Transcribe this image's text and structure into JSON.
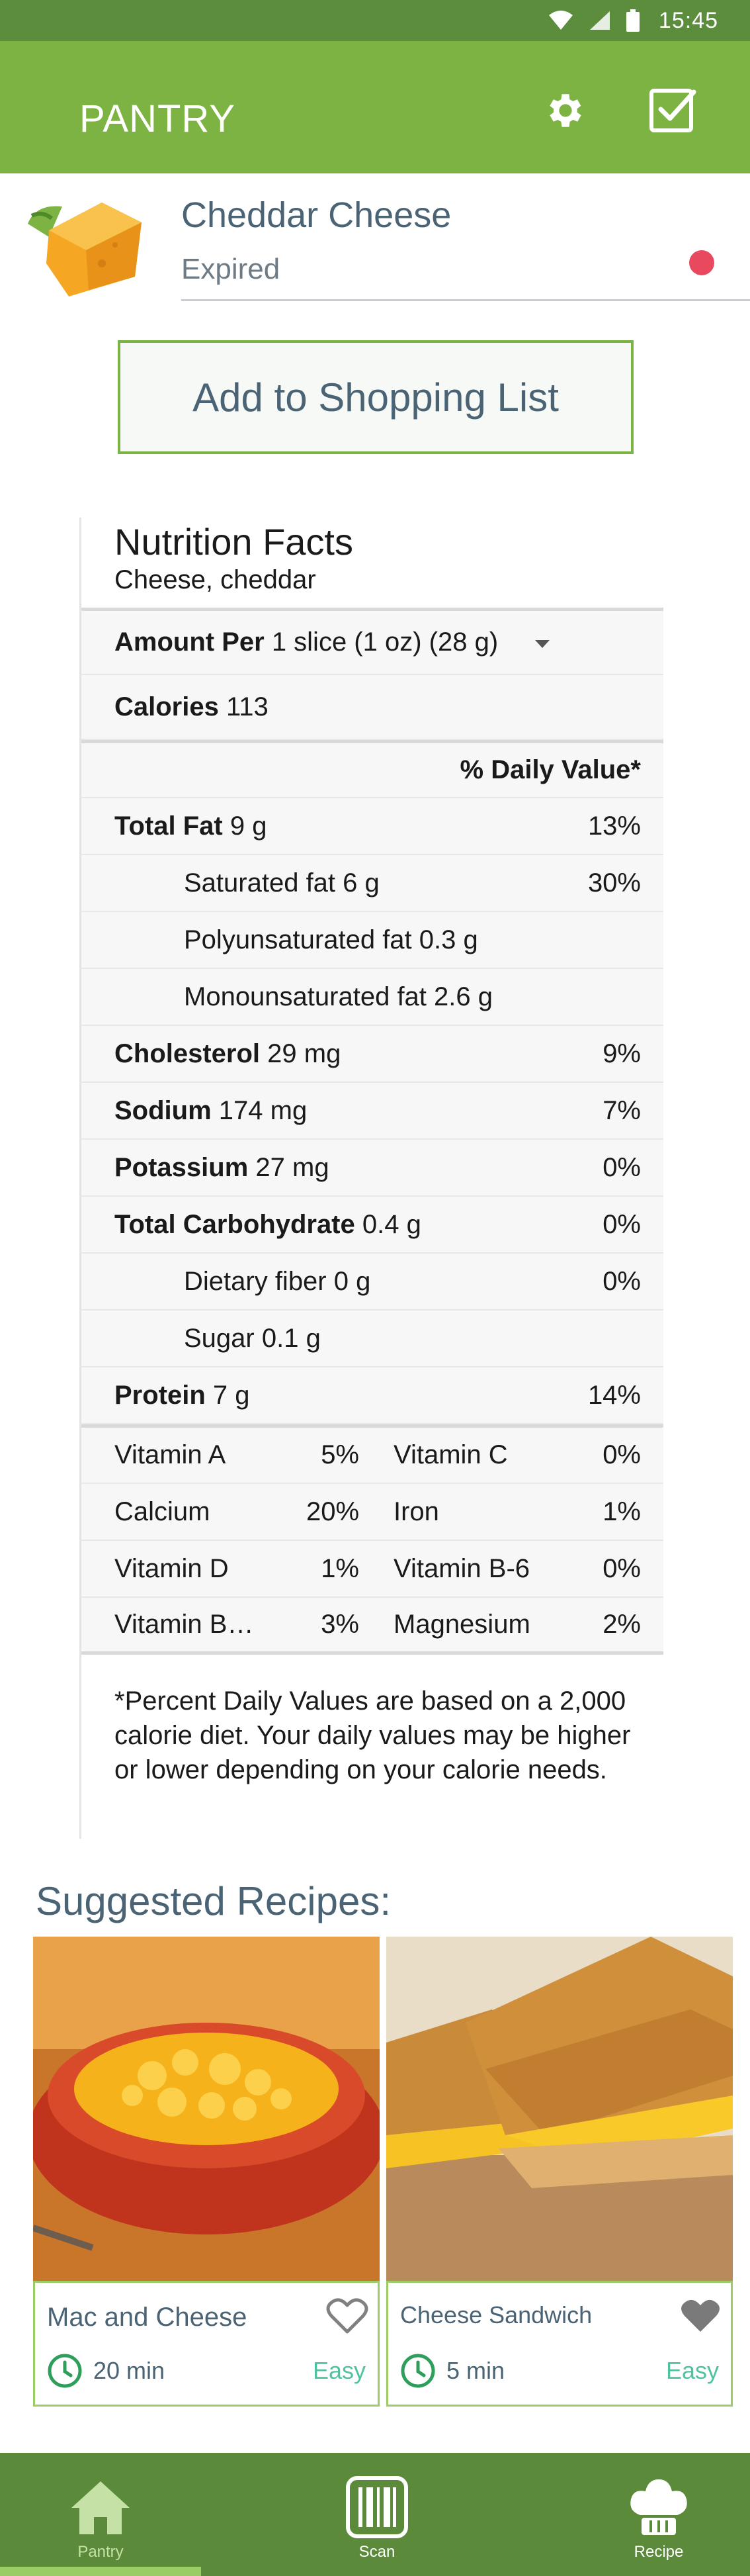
{
  "status_bar": {
    "time": "15:45"
  },
  "app_bar": {
    "title": "PANTRY"
  },
  "item": {
    "name": "Cheddar Cheese",
    "status": "Expired"
  },
  "actions": {
    "add_to_list": "Add to Shopping List"
  },
  "nutrition": {
    "title": "Nutrition Facts",
    "subtitle": "Cheese, cheddar",
    "amount_per_label": "Amount Per",
    "serving": "1 slice (1 oz) (28 g)",
    "calories_label": "Calories",
    "calories_value": "113",
    "daily_value_header": "% Daily Value*",
    "rows": [
      {
        "label": "Total Fat",
        "amount": "9 g",
        "pct": "13%"
      },
      {
        "label": "Saturated fat",
        "amount": "6 g",
        "pct": "30%"
      },
      {
        "label": "Polyunsaturated fat",
        "amount": "0.3 g",
        "pct": ""
      },
      {
        "label": "Monounsaturated fat",
        "amount": "2.6 g",
        "pct": ""
      },
      {
        "label": "Cholesterol",
        "amount": "29 mg",
        "pct": "9%"
      },
      {
        "label": "Sodium",
        "amount": "174 mg",
        "pct": "7%"
      },
      {
        "label": "Potassium",
        "amount": "27 mg",
        "pct": "0%"
      },
      {
        "label": "Total Carbohydrate",
        "amount": "0.4 g",
        "pct": "0%"
      },
      {
        "label": "Dietary fiber",
        "amount": "0 g",
        "pct": "0%"
      },
      {
        "label": "Sugar",
        "amount": "0.1 g",
        "pct": ""
      },
      {
        "label": "Protein",
        "amount": "7 g",
        "pct": "14%"
      }
    ],
    "vitamins": [
      {
        "left_name": "Vitamin A",
        "left_pct": "5%",
        "right_name": "Vitamin C",
        "right_pct": "0%"
      },
      {
        "left_name": "Calcium",
        "left_pct": "20%",
        "right_name": "Iron",
        "right_pct": "1%"
      },
      {
        "left_name": "Vitamin D",
        "left_pct": "1%",
        "right_name": "Vitamin B-6",
        "right_pct": "0%"
      },
      {
        "left_name": "Vitamin B…",
        "left_pct": "3%",
        "right_name": "Magnesium",
        "right_pct": "2%"
      }
    ],
    "footnote": "*Percent Daily Values are based on a 2,000 calorie diet. Your daily values may be higher or lower depending on your calorie needs."
  },
  "recipes": {
    "heading": "Suggested Recipes:",
    "items": [
      {
        "name": "Mac and Cheese",
        "time": "20 min",
        "difficulty": "Easy"
      },
      {
        "name": "Cheese Sandwich",
        "time": "5 min",
        "difficulty": "Easy"
      }
    ]
  },
  "bottom_nav": {
    "items": [
      {
        "label": "Pantry"
      },
      {
        "label": "Scan"
      },
      {
        "label": "Recipe"
      }
    ]
  },
  "colors": {
    "primary": "#7cb342",
    "primary_dark": "#5b8a3b",
    "text_slate": "#4b6475",
    "expired_dot": "#e8495f",
    "easy_teal": "#4fc3a1"
  }
}
